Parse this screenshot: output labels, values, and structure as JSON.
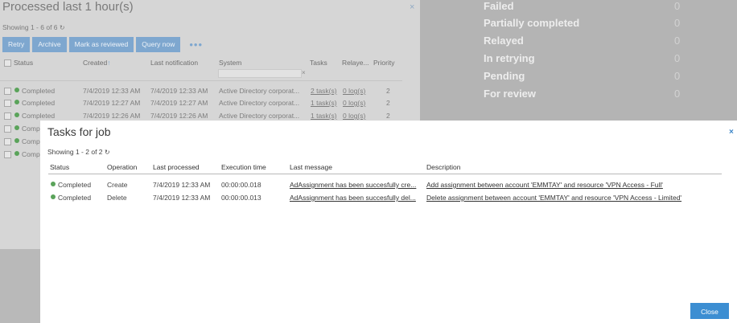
{
  "background": {
    "panel_title": "Processed last 1 hour(s)",
    "close_glyph": "×",
    "showing": "Showing 1 - 6 of 6",
    "refresh_glyph": "↻",
    "toolbar": [
      "Retry",
      "Archive",
      "Mark as reviewed",
      "Query now"
    ],
    "more_glyph": "•••",
    "columns": [
      "Status",
      "Created",
      "Last notification",
      "System",
      "Tasks",
      "Relaye...",
      "Priority"
    ],
    "sort_glyph": "↑",
    "filter_clear": "×",
    "rows": [
      {
        "status": "Completed",
        "created": "7/4/2019 12:33 AM",
        "last_notification": "7/4/2019 12:33 AM",
        "system": "Active Directory corporat...",
        "tasks": "2 task(s)",
        "relayed": "0 log(s)",
        "priority": "2"
      },
      {
        "status": "Completed",
        "created": "7/4/2019 12:27 AM",
        "last_notification": "7/4/2019 12:27 AM",
        "system": "Active Directory corporat...",
        "tasks": "1 task(s)",
        "relayed": "0 log(s)",
        "priority": "2"
      },
      {
        "status": "Completed",
        "created": "7/4/2019 12:26 AM",
        "last_notification": "7/4/2019 12:26 AM",
        "system": "Active Directory corporat...",
        "tasks": "1 task(s)",
        "relayed": "0 log(s)",
        "priority": "2"
      },
      {
        "status": "Comp"
      },
      {
        "status": "Comp"
      },
      {
        "status": "Comp"
      }
    ],
    "stats": [
      {
        "label": "Failed",
        "value": "0"
      },
      {
        "label": "Partially completed",
        "value": "0"
      },
      {
        "label": "Relayed",
        "value": "0"
      },
      {
        "label": "In retrying",
        "value": "0"
      },
      {
        "label": "Pending",
        "value": "0"
      },
      {
        "label": "For review",
        "value": "0"
      }
    ]
  },
  "modal": {
    "title": "Tasks for job",
    "close_glyph": "×",
    "showing": "Showing 1 - 2 of 2",
    "refresh_glyph": "↻",
    "columns": [
      "Status",
      "Operation",
      "Last processed",
      "Execution time",
      "Last message",
      "Description"
    ],
    "rows": [
      {
        "status": "Completed",
        "operation": "Create",
        "last_processed": "7/4/2019 12:33 AM",
        "execution_time": "00:00:00.018",
        "last_message": "AdAssignment has been succesfully cre...",
        "description": "Add assignment between account 'EMMTAY' and resource 'VPN Access - Full'"
      },
      {
        "status": "Completed",
        "operation": "Delete",
        "last_processed": "7/4/2019 12:33 AM",
        "execution_time": "00:00:00.013",
        "last_message": "AdAssignment has been succesfully del...",
        "description": "Delete assignment between account 'EMMTAY' and resource 'VPN Access - Limited'"
      }
    ],
    "close_label": "Close"
  },
  "colors": {
    "accent": "#3c8ed2",
    "status_completed": "#5aa35a"
  }
}
